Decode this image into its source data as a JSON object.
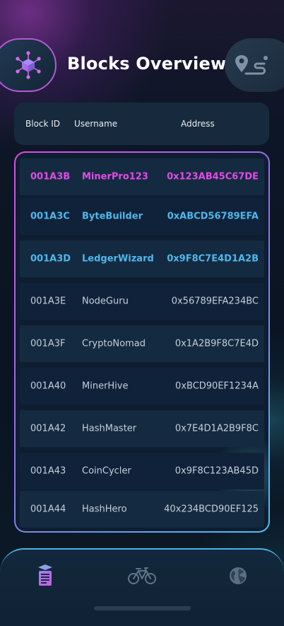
{
  "header": {
    "title": "Blocks Overview",
    "logo_icon": "blockchain-network-icon",
    "map_icon": "map-route-icon"
  },
  "table": {
    "columns": [
      "Block ID",
      "Username",
      "Address"
    ],
    "rows": [
      {
        "id": "001A3B",
        "username": "MinerPro123",
        "address": "0x123AB45C67DE",
        "state": "highlight-pink"
      },
      {
        "id": "001A3C",
        "username": "ByteBuilder",
        "address": "0xABCD56789EFA",
        "state": "highlight-blue"
      },
      {
        "id": "001A3D",
        "username": "LedgerWizard",
        "address": "0x9F8C7E4D1A2B",
        "state": "highlight-blue"
      },
      {
        "id": "001A3E",
        "username": "NodeGuru",
        "address": "0x56789EFA234BC",
        "state": "normal"
      },
      {
        "id": "001A3F",
        "username": "CryptoNomad",
        "address": "0x1A2B9F8C7E4D",
        "state": "normal"
      },
      {
        "id": "001A40",
        "username": "MinerHive",
        "address": "0xBCD90EF1234A",
        "state": "normal"
      },
      {
        "id": "001A42",
        "username": "HashMaster",
        "address": "0x7E4D1A2B9F8C",
        "state": "normal"
      },
      {
        "id": "001A43",
        "username": "CoinCycler",
        "address": "0x9F8C123AB45D",
        "state": "normal"
      },
      {
        "id": "001A44",
        "username": "HashHero",
        "address": "40x234BCD90EF125",
        "state": "normal"
      }
    ]
  },
  "bottom_nav": {
    "items": [
      {
        "icon": "block-document-icon",
        "active": true
      },
      {
        "icon": "bicycle-icon",
        "active": false
      },
      {
        "icon": "globe-icon",
        "active": false
      }
    ]
  },
  "colors": {
    "accent_pink": "#e24be6",
    "accent_blue": "#4cb8ec",
    "background": "#0b1624"
  }
}
